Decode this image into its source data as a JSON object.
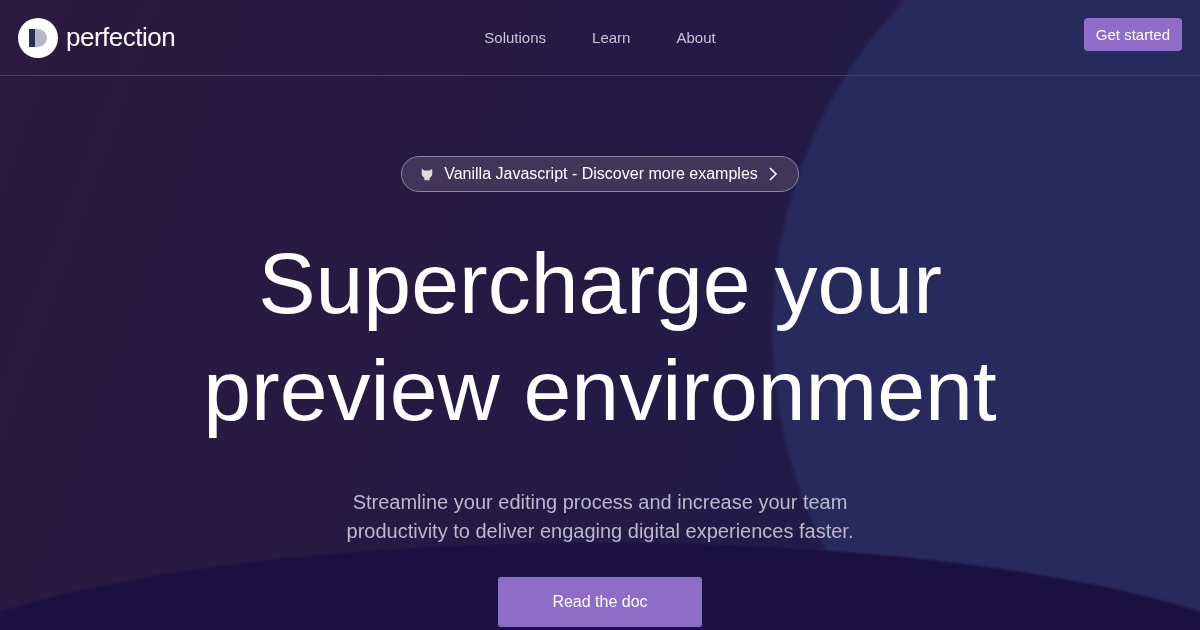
{
  "brand": {
    "name": "perfection"
  },
  "nav": [
    {
      "label": "Solutions"
    },
    {
      "label": "Learn"
    },
    {
      "label": "About"
    }
  ],
  "header_button": "Get started",
  "announcement": {
    "text": "Vanilla Javascript - Discover more examples"
  },
  "headline": [
    "Supercharge your",
    "preview environment"
  ],
  "subtitle": [
    "Streamline your editing process and increase your team",
    "productivity to deliver engaging digital experiences faster."
  ],
  "cta": "Read the doc"
}
